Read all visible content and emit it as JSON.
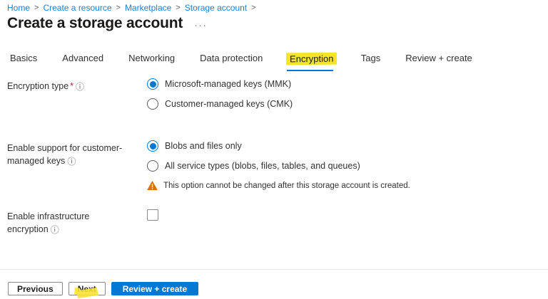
{
  "colors": {
    "accent": "#0078d4",
    "highlight": "#f6e32c",
    "warning": "#db7500",
    "link": "#1b7fd4"
  },
  "breadcrumb": {
    "separator": ">",
    "items": [
      "Home",
      "Create a resource",
      "Marketplace",
      "Storage account"
    ]
  },
  "page": {
    "title": "Create a storage account",
    "more_menu": "···"
  },
  "tabs": {
    "items": [
      {
        "label": "Basics",
        "active": false
      },
      {
        "label": "Advanced",
        "active": false
      },
      {
        "label": "Networking",
        "active": false
      },
      {
        "label": "Data protection",
        "active": false
      },
      {
        "label": "Encryption",
        "active": true
      },
      {
        "label": "Tags",
        "active": false
      },
      {
        "label": "Review + create",
        "active": false
      }
    ]
  },
  "icons": {
    "info": "ⓘ"
  },
  "form": {
    "encryption_type": {
      "label": "Encryption type",
      "required": "*",
      "options": [
        {
          "label": "Microsoft-managed keys (MMK)",
          "selected": true
        },
        {
          "label": "Customer-managed keys (CMK)",
          "selected": false
        }
      ]
    },
    "cmk_support": {
      "label": "Enable support for customer-managed keys",
      "options": [
        {
          "label": "Blobs and files only",
          "selected": true
        },
        {
          "label": "All service types (blobs, files, tables, and queues)",
          "selected": false
        }
      ],
      "warning": "This option cannot be changed after this storage account is created."
    },
    "infrastructure_encryption": {
      "label": "Enable infrastructure encryption",
      "checked": false
    }
  },
  "footer": {
    "previous": "Previous",
    "next": "Next",
    "review_create": "Review + create"
  }
}
